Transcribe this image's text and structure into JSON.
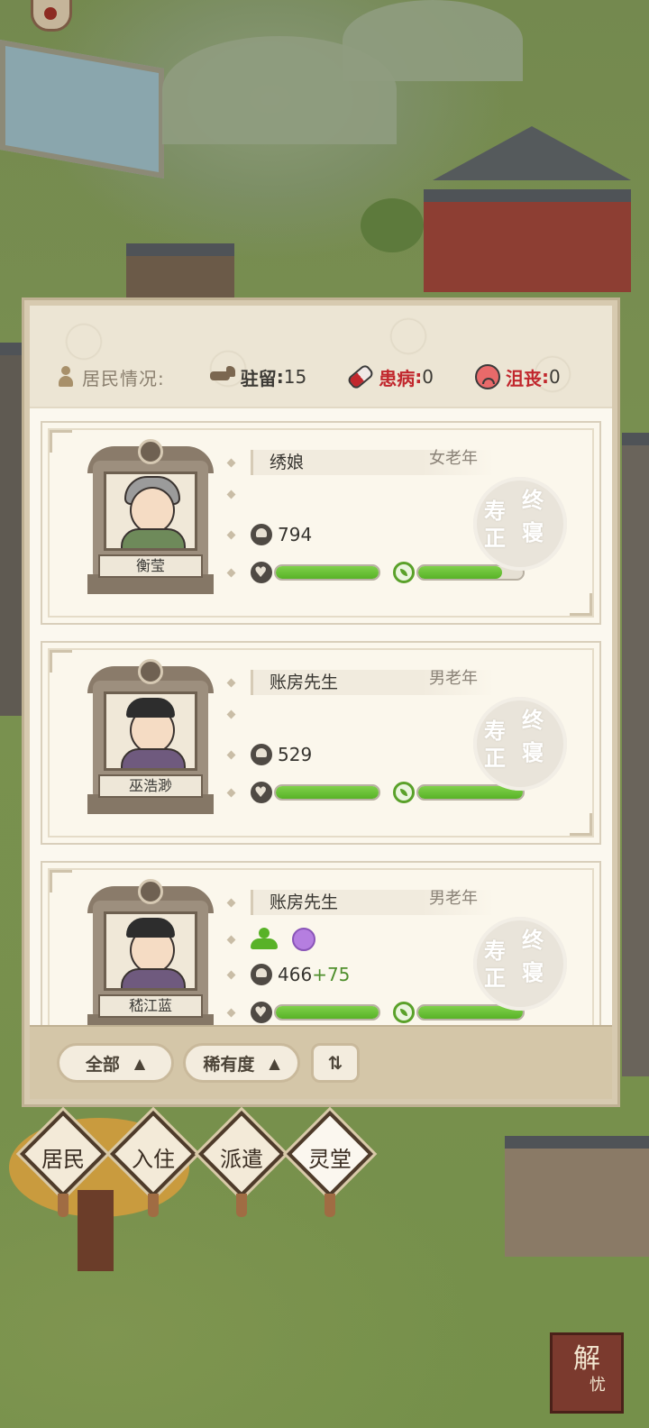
{
  "header": {
    "title": "居民情况:",
    "stats": [
      {
        "label": "驻留",
        "sep": ":",
        "value": "15",
        "icon": "horse-icon"
      },
      {
        "label": "患病",
        "sep": ":",
        "value": "0",
        "icon": "pill-icon"
      },
      {
        "label": "沮丧",
        "sep": ":",
        "value": "0",
        "icon": "sad-face-icon"
      }
    ]
  },
  "residents": [
    {
      "name": "衡莹",
      "role": "绣娘",
      "age": "女老年",
      "power": "794",
      "power_bonus": "",
      "health": 1.0,
      "vitality": 0.8,
      "status_seal": [
        "寿",
        "终",
        "正",
        "寝"
      ]
    },
    {
      "name": "巫浩渺",
      "role": "账房先生",
      "age": "男老年",
      "power": "529",
      "power_bonus": "",
      "health": 1.0,
      "vitality": 1.0,
      "status_seal": [
        "寿",
        "终",
        "正",
        "寝"
      ]
    },
    {
      "name": "嵇江蓝",
      "role": "账房先生",
      "age": "男老年",
      "power": "466",
      "power_bonus": "+75",
      "health": 1.0,
      "vitality": 1.0,
      "status_seal": [
        "寿",
        "终",
        "正",
        "寝"
      ]
    }
  ],
  "filters": {
    "all": "全部",
    "rarity": "稀有度",
    "sort_icon": "sort-icon"
  },
  "tabs": [
    {
      "label": "居民",
      "active": false
    },
    {
      "label": "入住",
      "active": false
    },
    {
      "label": "派遣",
      "active": false
    },
    {
      "label": "灵堂",
      "active": true
    }
  ],
  "map_stamp": [
    "解",
    "忧"
  ],
  "colors": {
    "accent_green": "#58b227",
    "warning_red": "#c1272d",
    "panel_bg": "#fbf8ef"
  }
}
